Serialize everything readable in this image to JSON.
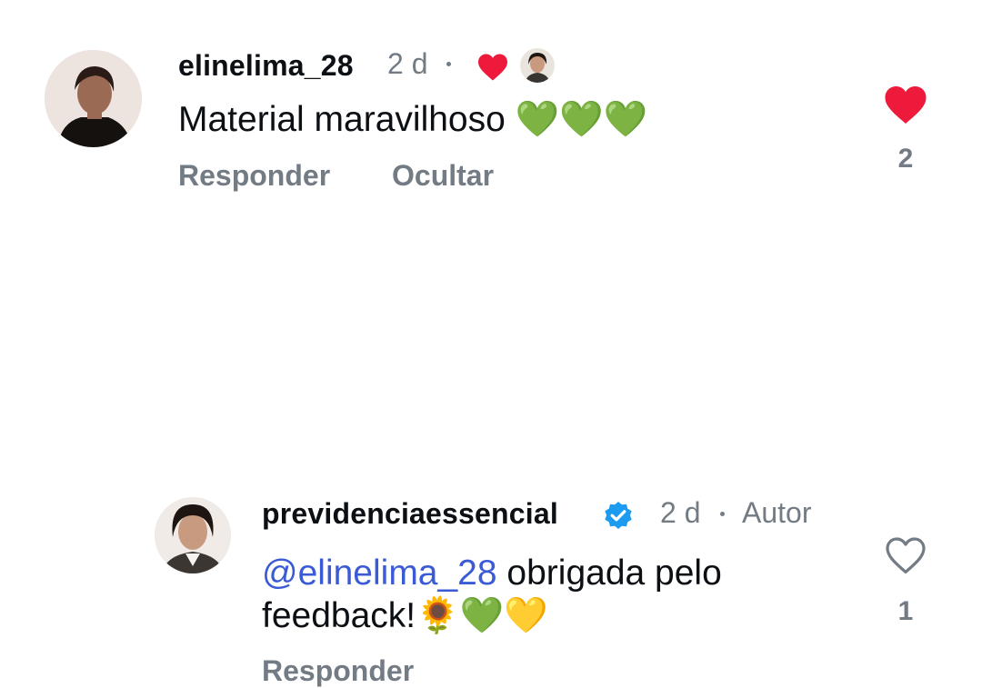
{
  "comments": [
    {
      "username": "elinelima_28",
      "time": "2 d",
      "text": "Material maravilhoso",
      "emoji": "💚💚💚",
      "reply_label": "Responder",
      "hide_label": "Ocultar",
      "like_count": "2",
      "liked": true,
      "liked_by_author": true
    },
    {
      "username": "previdenciaessencial",
      "verified": true,
      "time": "2 d",
      "author_badge": "Autor",
      "mention": "@elinelima_28",
      "text_line1_rest": " obrigada pelo",
      "text_line2": "feedback!",
      "emoji": "🌻💚💛",
      "reply_label": "Responder",
      "like_count": "1",
      "liked": false
    }
  ],
  "colors": {
    "heart": "#ed1a3b",
    "verified": "#1d9bf0",
    "mention": "#3b5bd6",
    "muted": "#737b84"
  }
}
